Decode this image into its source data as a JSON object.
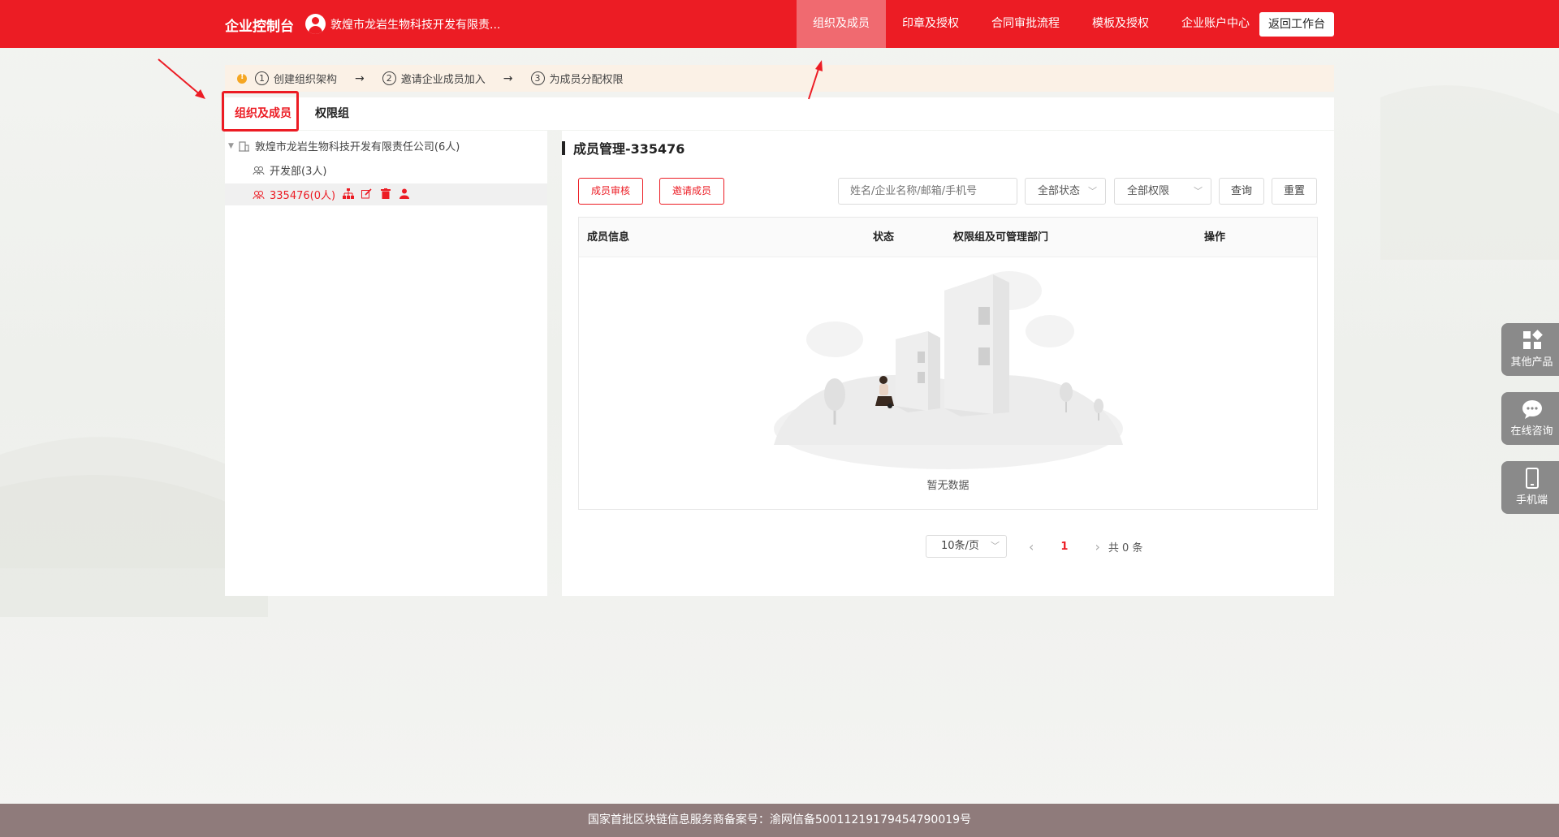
{
  "header": {
    "brand": "企业控制台",
    "company_name": "敦煌市龙岩生物科技开发有限责...",
    "nav": [
      {
        "label": "组织及成员"
      },
      {
        "label": "印章及授权"
      },
      {
        "label": "合同审批流程"
      },
      {
        "label": "模板及授权"
      },
      {
        "label": "企业账户中心"
      }
    ],
    "back_label": "返回工作台"
  },
  "tips": {
    "steps": [
      {
        "num": "1",
        "label": "创建组织架构"
      },
      {
        "num": "2",
        "label": "邀请企业成员加入"
      },
      {
        "num": "3",
        "label": "为成员分配权限"
      }
    ],
    "arrow": "→"
  },
  "tabs": [
    {
      "label": "组织及成员"
    },
    {
      "label": "权限组"
    }
  ],
  "tree": {
    "root": "敦煌市龙岩生物科技开发有限责任公司(6人)",
    "children": [
      {
        "label": "开发部(3人)"
      },
      {
        "label": "335476(0人)"
      }
    ]
  },
  "members": {
    "title": "成员管理-335476",
    "review_btn": "成员审核",
    "invite_btn": "邀请成员",
    "search_placeholder": "姓名/企业名称/邮箱/手机号",
    "status_select": "全部状态",
    "perm_select": "全部权限",
    "query_btn": "查询",
    "reset_btn": "重置",
    "columns": [
      "成员信息",
      "状态",
      "权限组及可管理部门",
      "操作"
    ],
    "empty_text": "暂无数据"
  },
  "pagination": {
    "page_size": "10条/页",
    "prev": "‹",
    "current": "1",
    "next": "›",
    "total": "共 0 条"
  },
  "side": [
    {
      "label": "其他产品"
    },
    {
      "label": "在线咨询"
    },
    {
      "label": "手机端"
    }
  ],
  "footer": {
    "text": "国家首批区块链信息服务商备案号：渝网信备50011219179454790019号"
  },
  "colors": {
    "brand_red": "#ec1c24",
    "nav_active": "#f06a70",
    "tip_bg": "#fbf1e6",
    "footer_bg": "#8f7b7b"
  }
}
